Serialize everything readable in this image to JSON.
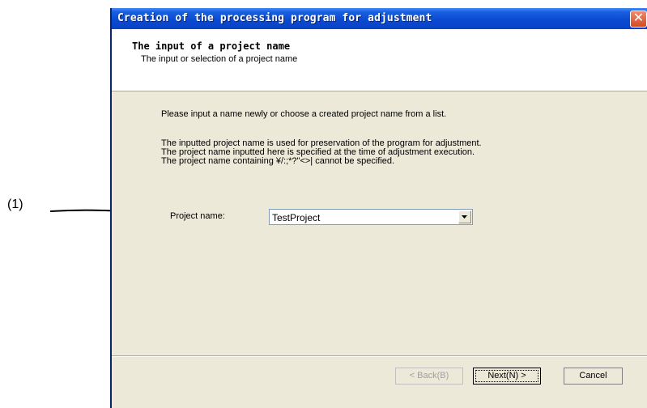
{
  "annotation": {
    "label": "(1)"
  },
  "window": {
    "title": "Creation of the processing program for adjustment",
    "close_glyph": "✕"
  },
  "header": {
    "title": "The input of a project name",
    "subtitle": "The input or selection of a project name"
  },
  "body": {
    "instruction": "Please input a name newly or choose a created project name from a list.",
    "notes": [
      "The inputted project name is used for preservation of the program for adjustment.",
      "The project name inputted here is specified at the time of adjustment execution.",
      "The project name containing ¥/:;*?\"<>| cannot be specified."
    ]
  },
  "form": {
    "project_label": "Project name:",
    "project_value": "TestProject"
  },
  "buttons": {
    "back": "< Back(B)",
    "next": "Next(N) >",
    "cancel": "Cancel"
  },
  "colors": {
    "titlebar": "#0a49d1",
    "dialog_bg": "#ece9d8",
    "close": "#d44a24"
  }
}
